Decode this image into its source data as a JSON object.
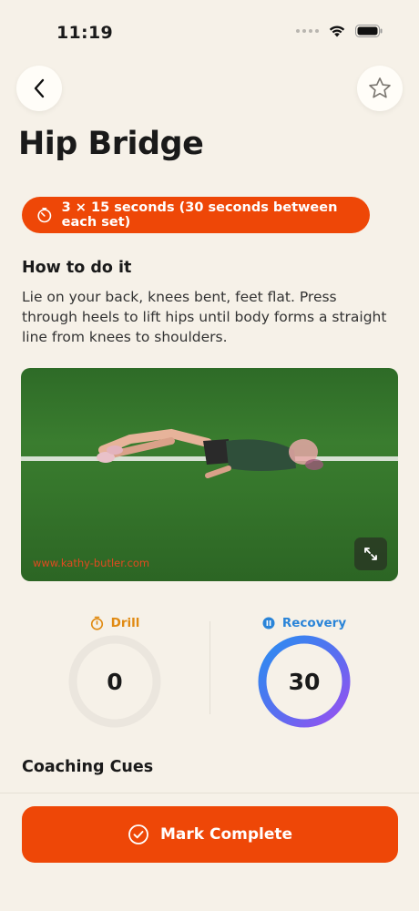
{
  "status_bar": {
    "time": "11:19"
  },
  "header": {
    "title": "Hip Bridge"
  },
  "duration": {
    "label": "3 × 15 seconds (30 seconds between each set)"
  },
  "how_to": {
    "heading": "How to do it",
    "text": "Lie on your back, knees bent, feet flat. Press through heels to lift hips until body forms a straight line from knees to shoulders."
  },
  "video": {
    "watermark": "www.kathy-butler.com"
  },
  "timers": {
    "drill": {
      "label": "Drill",
      "value": "0",
      "progress": 0,
      "color": "#e08a12"
    },
    "recovery": {
      "label": "Recovery",
      "value": "30",
      "progress": 1,
      "color": "#2a84d8"
    }
  },
  "coaching": {
    "heading": "Coaching Cues"
  },
  "actions": {
    "complete_label": "Mark Complete"
  },
  "colors": {
    "accent": "#ee4707",
    "background": "#f6f1e8"
  }
}
